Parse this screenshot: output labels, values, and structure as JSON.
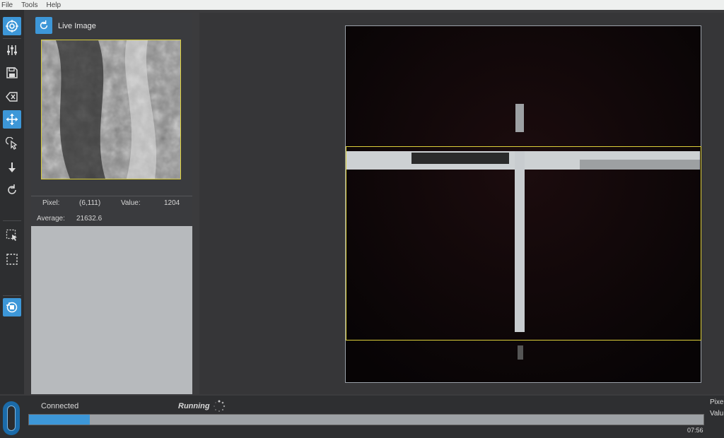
{
  "menu": {
    "items": [
      "File",
      "Tools",
      "Help"
    ]
  },
  "toolbar": {
    "buttons": [
      {
        "name": "target-icon",
        "active": true
      },
      {
        "name": "sliders-icon",
        "active": false
      },
      {
        "name": "save-icon",
        "active": false
      },
      {
        "name": "delete-icon",
        "active": false
      },
      {
        "name": "move-icon",
        "active": true
      },
      {
        "name": "pointer-click-icon",
        "active": false
      },
      {
        "name": "arrow-down-icon",
        "active": false
      },
      {
        "name": "refresh-icon",
        "active": false
      },
      {
        "name": "select-pointer-icon",
        "active": false
      },
      {
        "name": "selection-box-icon",
        "active": false
      },
      {
        "name": "reset-view-icon",
        "active": true
      }
    ]
  },
  "left_panel": {
    "title": "Live Image",
    "pixel_label": "Pixel:",
    "pixel_value": "(6,111)",
    "value_label": "Value:",
    "value_value": "1204",
    "average_label": "Average:",
    "average_value": "21632.6"
  },
  "status": {
    "connection": "Connected",
    "state": "Running",
    "progress": 0.09,
    "time": "07:56",
    "right_labels": [
      "Pixe",
      "Valu"
    ]
  },
  "colors": {
    "accent": "#3d97d8",
    "roi": "#dccf3a"
  }
}
